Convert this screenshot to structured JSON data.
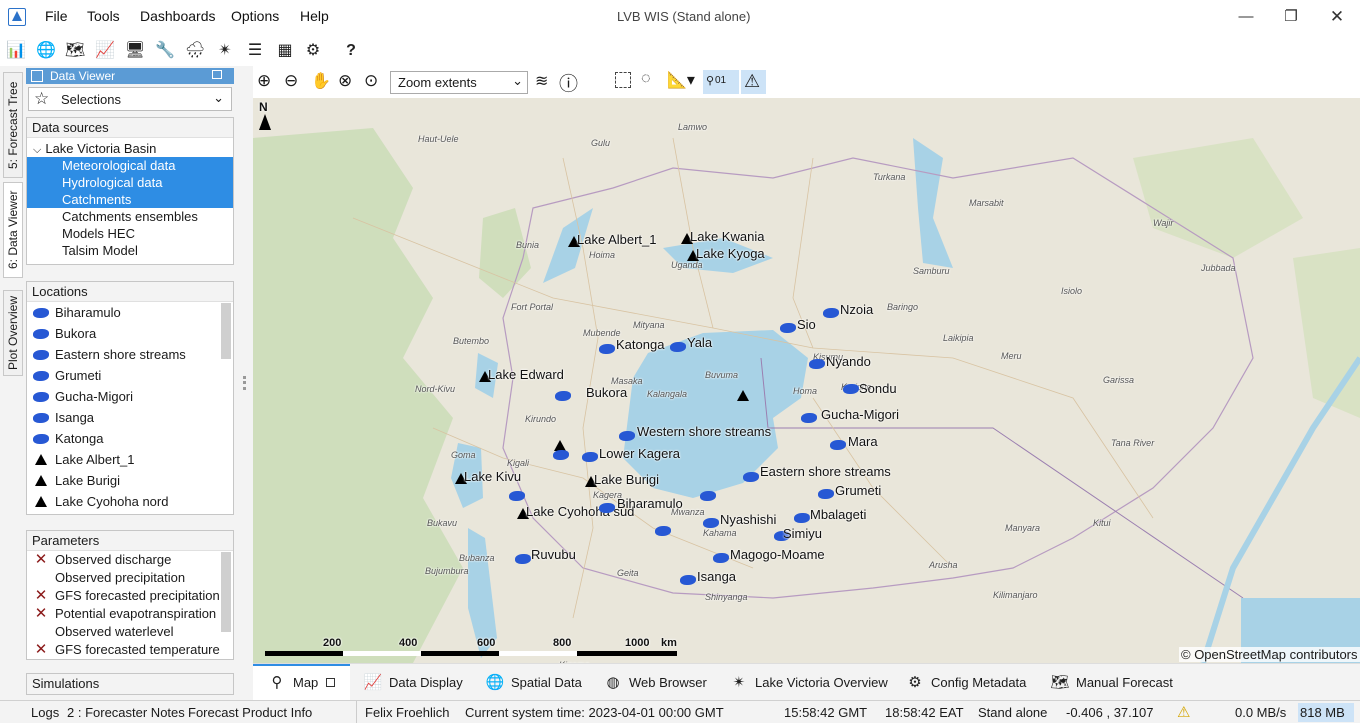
{
  "window": {
    "title": "LVB WIS  (Stand alone)"
  },
  "menu": [
    "File",
    "Tools",
    "Dashboards",
    "Options",
    "Help"
  ],
  "toolbar": {
    "help_label": "?"
  },
  "side_tabs": [
    "5: Forecast Tree",
    "6: Data Viewer",
    "Plot Overview"
  ],
  "data_viewer": {
    "title": "Data Viewer",
    "selection_value": "Selections",
    "data_sources_header": "Data sources",
    "root": "Lake Victoria Basin",
    "sources": [
      {
        "label": "Meteorological data",
        "selected": true
      },
      {
        "label": "Hydrological data",
        "selected": true
      },
      {
        "label": "Catchments",
        "selected": true
      },
      {
        "label": "Catchments ensembles",
        "selected": false
      },
      {
        "label": "Models HEC",
        "selected": false
      },
      {
        "label": "Talsim Model",
        "selected": false
      }
    ],
    "locations_header": "Locations",
    "locations": [
      {
        "label": "Biharamulo",
        "icon": "catchment-icon"
      },
      {
        "label": "Bukora",
        "icon": "catchment-icon"
      },
      {
        "label": "Eastern shore streams",
        "icon": "catchment-icon"
      },
      {
        "label": "Grumeti",
        "icon": "catchment-icon"
      },
      {
        "label": "Gucha-Migori",
        "icon": "catchment-icon"
      },
      {
        "label": "Isanga",
        "icon": "catchment-icon"
      },
      {
        "label": "Katonga",
        "icon": "catchment-icon"
      },
      {
        "label": "Lake Albert_1",
        "icon": "lake-station-icon"
      },
      {
        "label": "Lake Burigi",
        "icon": "lake-station-icon"
      },
      {
        "label": "Lake Cyohoha nord",
        "icon": "lake-station-icon"
      }
    ],
    "parameters_header": "Parameters",
    "parameters": [
      {
        "label": "Observed discharge",
        "unavailable": true
      },
      {
        "label": "Observed precipitation",
        "unavailable": false
      },
      {
        "label": "GFS forecasted precipitation",
        "unavailable": true
      },
      {
        "label": "Potential evapotranspiration",
        "unavailable": true
      },
      {
        "label": "Observed waterlevel",
        "unavailable": false
      },
      {
        "label": "GFS forecasted temperature",
        "unavailable": true
      }
    ],
    "simulations_header": "Simulations"
  },
  "map_toolbar": {
    "zoom_select": "Zoom extents",
    "layer_toggle": "01"
  },
  "map": {
    "north_label": "N",
    "scale_labels": [
      "200",
      "400",
      "600",
      "800",
      "1000",
      "km"
    ],
    "attribution": "© OpenStreetMap contributors",
    "lake_stations": [
      {
        "label": "Lake Albert_1"
      },
      {
        "label": "Lake Kwania"
      },
      {
        "label": "Lake Kyoga"
      },
      {
        "label": "Lake Edward"
      },
      {
        "label": ""
      },
      {
        "label": ""
      },
      {
        "label": "Lake Kivu"
      },
      {
        "label": "Lake Burigi"
      },
      {
        "label": "Lake Cyohoha sud"
      }
    ],
    "catchments": [
      {
        "label": "Nzoia"
      },
      {
        "label": "Sio"
      },
      {
        "label": "Katonga"
      },
      {
        "label": "Yala"
      },
      {
        "label": "Nyando"
      },
      {
        "label": "Sondu"
      },
      {
        "label": "Bukora"
      },
      {
        "label": "Gucha-Migori"
      },
      {
        "label": "Western shore streams"
      },
      {
        "label": "Mara"
      },
      {
        "label": "Lower Kagera"
      },
      {
        "label": "Eastern shore streams"
      },
      {
        "label": "Grumeti"
      },
      {
        "label": "Biharamulo"
      },
      {
        "label": "Mbalageti"
      },
      {
        "label": "Nyashishi"
      },
      {
        "label": "Simiyu"
      },
      {
        "label": "Ruvubu"
      },
      {
        "label": "Magogo-Moame"
      },
      {
        "label": "Isanga"
      }
    ],
    "places": [
      "Haut-Uele",
      "Lamwo",
      "Gulu",
      "Turkana",
      "Bunia",
      "Hoima",
      "Uganda",
      "Fort Portal",
      "Mityana",
      "Mubende",
      "Masaka",
      "Kalangala",
      "Buvuma",
      "Kisumu",
      "Homa",
      "Kericho",
      "Nord-Kivu",
      "Butembo",
      "Kirundo",
      "Goma",
      "Kigali",
      "Bukavu",
      "Bubanza",
      "Bujumbura",
      "Mwanza",
      "Geita",
      "Kagera",
      "Kahama",
      "Shinyanga",
      "Kigoma",
      "Arusha",
      "Kilimanjaro",
      "Manyara",
      "Meru",
      "Isiolo",
      "Marsabit",
      "Samburu",
      "Laikipia",
      "Garissa",
      "Baringo",
      "Wajir",
      "Tana River",
      "Jubbada",
      "Kitui"
    ]
  },
  "bottom_tabs": [
    "Map",
    "Data Display",
    "Spatial Data",
    "Web Browser",
    "Lake Victoria Overview",
    "Config Metadata",
    "Manual Forecast"
  ],
  "status": {
    "left_tabs": [
      "Logs",
      "2 : Forecaster Notes",
      "Forecast Product Info"
    ],
    "user": "Felix Froehlich",
    "system_time": "Current system time: 2023-04-01 00:00 GMT",
    "gmt": "15:58:42 GMT",
    "eat": "18:58:42 EAT",
    "mode": "Stand alone",
    "coords": "-0.406 , 37.107",
    "rate": "0.0 MB/s",
    "memory": "818 MB"
  }
}
